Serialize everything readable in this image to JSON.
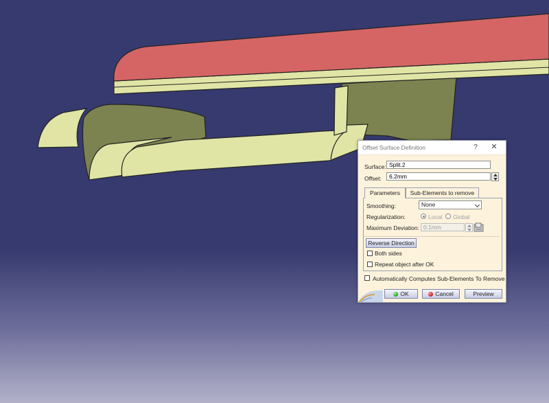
{
  "dialog": {
    "title": "Offset Surface Definition",
    "help": "?",
    "close": "✕",
    "surface_label": "Surface:",
    "surface_value": "Split.2",
    "offset_label": "Offset:",
    "offset_value": "6.2mm",
    "tabs": [
      "Parameters",
      "Sub-Elements to remove"
    ],
    "smoothing_label": "Smoothing:",
    "smoothing_value": "None",
    "regularization_label": "Regularization:",
    "regularization_options": [
      "Local",
      "Global"
    ],
    "max_dev_label": "Maximum Deviation:",
    "max_dev_value": "0.1mm",
    "reverse_direction": "Reverse Direction",
    "both_sides": "Both sides",
    "repeat_object": "Repeat object after OK",
    "auto_compute": "Automatically Computes Sub-Elements To Remove",
    "ok": "OK",
    "cancel": "Cancel",
    "preview": "Preview"
  },
  "colors": {
    "background_top": "#363a6e",
    "background_bottom": "#b2b1c9",
    "surface_red": "#d56565",
    "surface_yellow": "#e0e5a6",
    "surface_olive": "#7c8350"
  }
}
